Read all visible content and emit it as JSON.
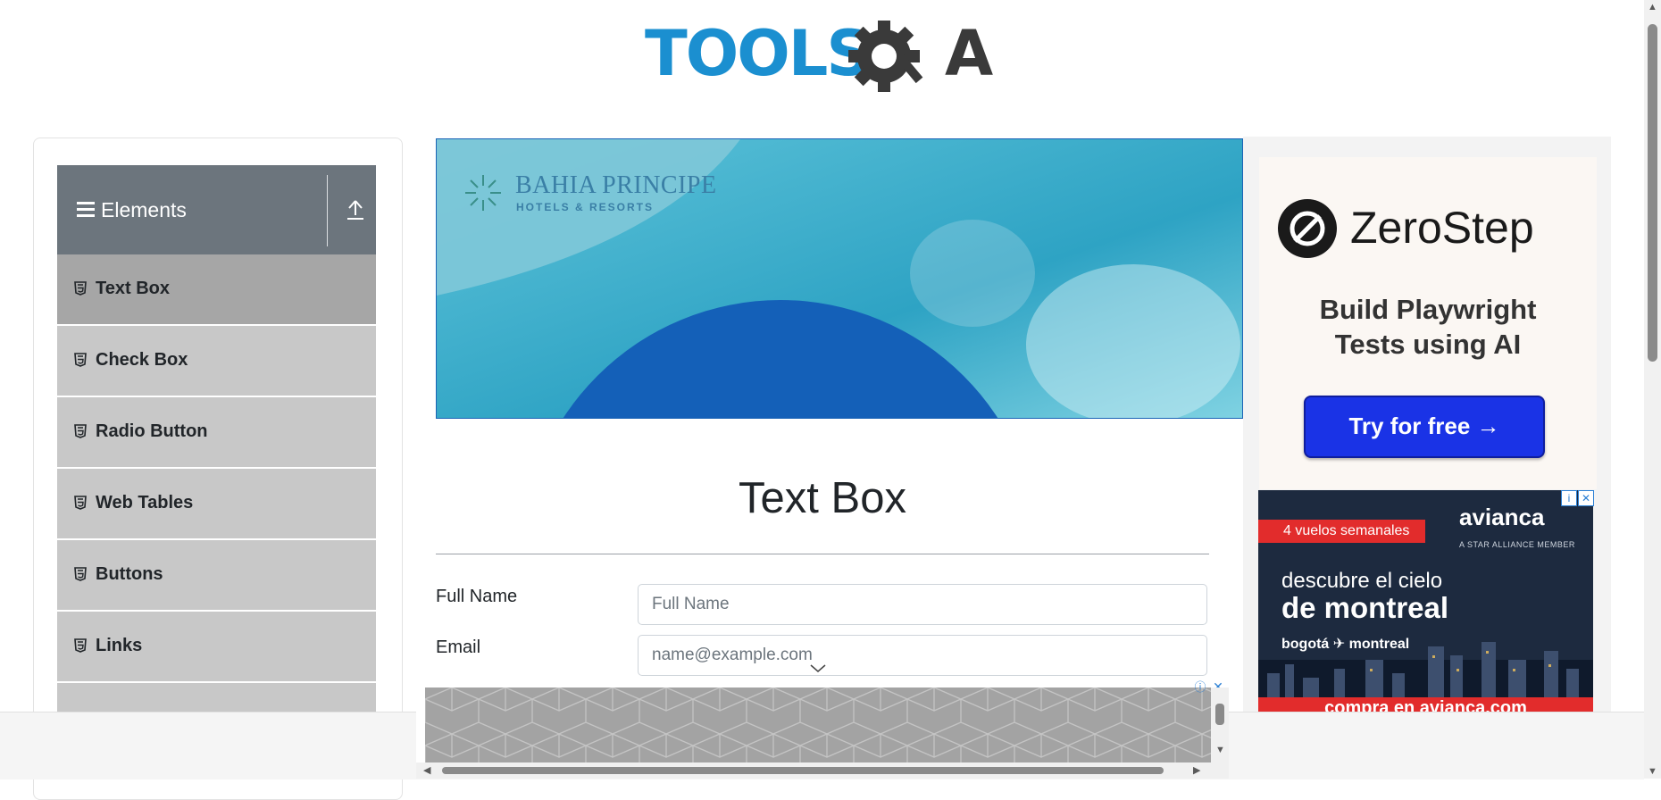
{
  "header": {
    "logo_text": "TOOLSQA"
  },
  "sidebar": {
    "group_title": "Elements",
    "items": [
      {
        "label": "Text Box",
        "active": true
      },
      {
        "label": "Check Box",
        "active": false
      },
      {
        "label": "Radio Button",
        "active": false
      },
      {
        "label": "Web Tables",
        "active": false
      },
      {
        "label": "Buttons",
        "active": false
      },
      {
        "label": "Links",
        "active": false
      }
    ]
  },
  "banner_ad": {
    "brand": "BAHIA PRINCIPE",
    "tagline": "HOTELS & RESORTS"
  },
  "main": {
    "title": "Text Box",
    "fields": [
      {
        "label": "Full Name",
        "placeholder": "Full Name",
        "value": ""
      },
      {
        "label": "Email",
        "placeholder": "name@example.com",
        "value": ""
      }
    ]
  },
  "right_ads": {
    "zerostep": {
      "brand": "ZeroStep",
      "tagline_line1": "Build Playwright",
      "tagline_line2": "Tests using AI",
      "cta": "Try for free →"
    },
    "avianca": {
      "badge": "4 vuelos semanales",
      "brand": "avianca",
      "alliance": "A STAR ALLIANCE MEMBER",
      "line1": "descubre el cielo",
      "line2": "de montreal",
      "route": "bogotá ✈ montreal",
      "cta": "compra en avianca.com"
    }
  },
  "colors": {
    "sidebar_header": "#6c757d",
    "menu_item": "#c8c8c8",
    "menu_item_active": "#a6a6a6",
    "logo_blue": "#1b8fd0",
    "logo_gray": "#3a3a3a"
  }
}
